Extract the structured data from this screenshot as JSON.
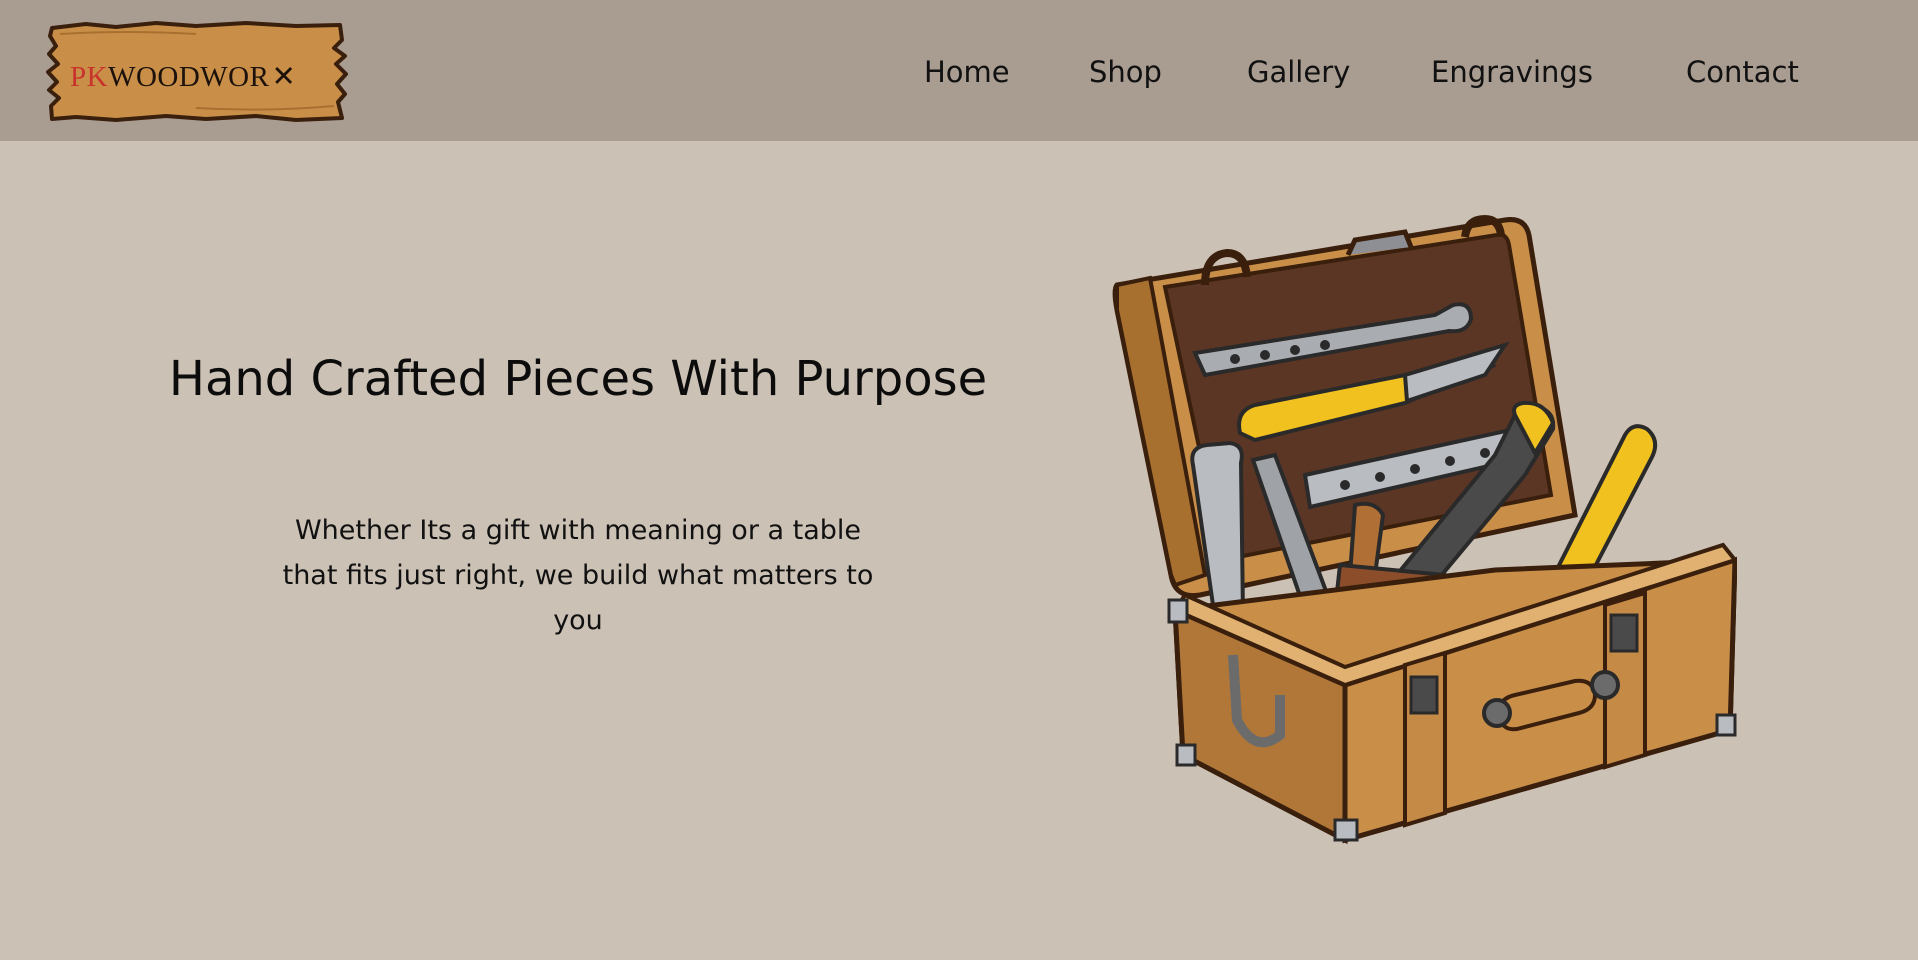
{
  "header": {
    "logo": {
      "prefix": "PK",
      "main": "WOODWOR",
      "suffix": "✕"
    },
    "nav": [
      {
        "label": "Home"
      },
      {
        "label": "Shop"
      },
      {
        "label": "Gallery"
      },
      {
        "label": "Engravings"
      },
      {
        "label": "Contact"
      }
    ]
  },
  "hero": {
    "title": "Hand Crafted Pieces With Purpose",
    "subtitle": "Whether Its a gift with meaning or a table that fits just right, we build what matters to you",
    "illustration": "toolbox-illustration"
  },
  "colors": {
    "header_bg": "#a99c91",
    "page_bg": "#ccc1b5",
    "logo_board": "#c98f49",
    "logo_border": "#3a1f0d",
    "logo_accent": "#c9332c"
  }
}
